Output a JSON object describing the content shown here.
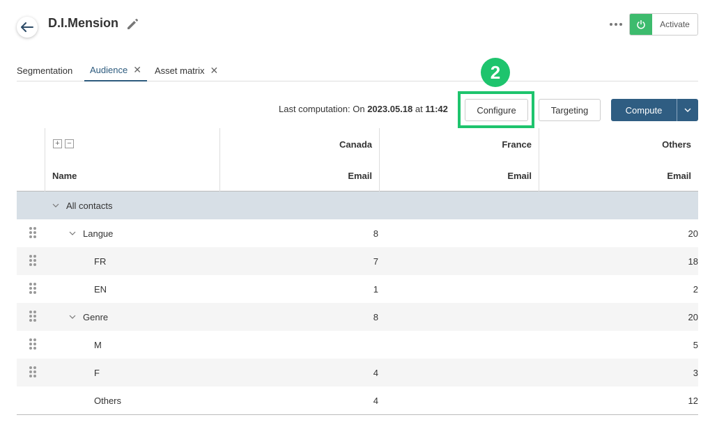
{
  "header": {
    "title": "D.I.Mension",
    "activate_label": "Activate"
  },
  "tabs": [
    {
      "label": "Segmentation",
      "closable": false,
      "active": false
    },
    {
      "label": "Audience",
      "closable": true,
      "active": true
    },
    {
      "label": "Asset matrix",
      "closable": true,
      "active": false
    }
  ],
  "badge": "2",
  "toolbar": {
    "last_prefix": "Last computation: On ",
    "last_date": "2023.05.18",
    "last_at": " at ",
    "last_time": "11:42",
    "configure_label": "Configure",
    "targeting_label": "Targeting",
    "compute_label": "Compute"
  },
  "table": {
    "columns": [
      {
        "group": "Canada",
        "sub": "Email"
      },
      {
        "group": "France",
        "sub": "Email"
      },
      {
        "group": "Others",
        "sub": "Email"
      }
    ],
    "name_header": "Name",
    "rows": [
      {
        "label": "All contacts",
        "level": 0,
        "expandable": true,
        "draggable": false,
        "canada": "",
        "others": ""
      },
      {
        "label": "Langue",
        "level": 1,
        "expandable": true,
        "draggable": true,
        "canada": "8",
        "others": "20"
      },
      {
        "label": "FR",
        "level": 2,
        "expandable": false,
        "draggable": true,
        "canada": "7",
        "others": "18"
      },
      {
        "label": "EN",
        "level": 2,
        "expandable": false,
        "draggable": true,
        "canada": "1",
        "others": "2"
      },
      {
        "label": "Genre",
        "level": 1,
        "expandable": true,
        "draggable": true,
        "canada": "8",
        "others": "20"
      },
      {
        "label": "M",
        "level": 2,
        "expandable": false,
        "draggable": true,
        "canada": "",
        "others": "5"
      },
      {
        "label": "F",
        "level": 2,
        "expandable": false,
        "draggable": true,
        "canada": "4",
        "others": "3"
      },
      {
        "label": "Others",
        "level": 2,
        "expandable": false,
        "draggable": false,
        "canada": "4",
        "others": "12"
      }
    ]
  },
  "colors": {
    "accent": "#2f5d82",
    "highlight": "#1ec46d",
    "activate_green": "#3dbb6d",
    "group_row": "#d7dfe6"
  }
}
